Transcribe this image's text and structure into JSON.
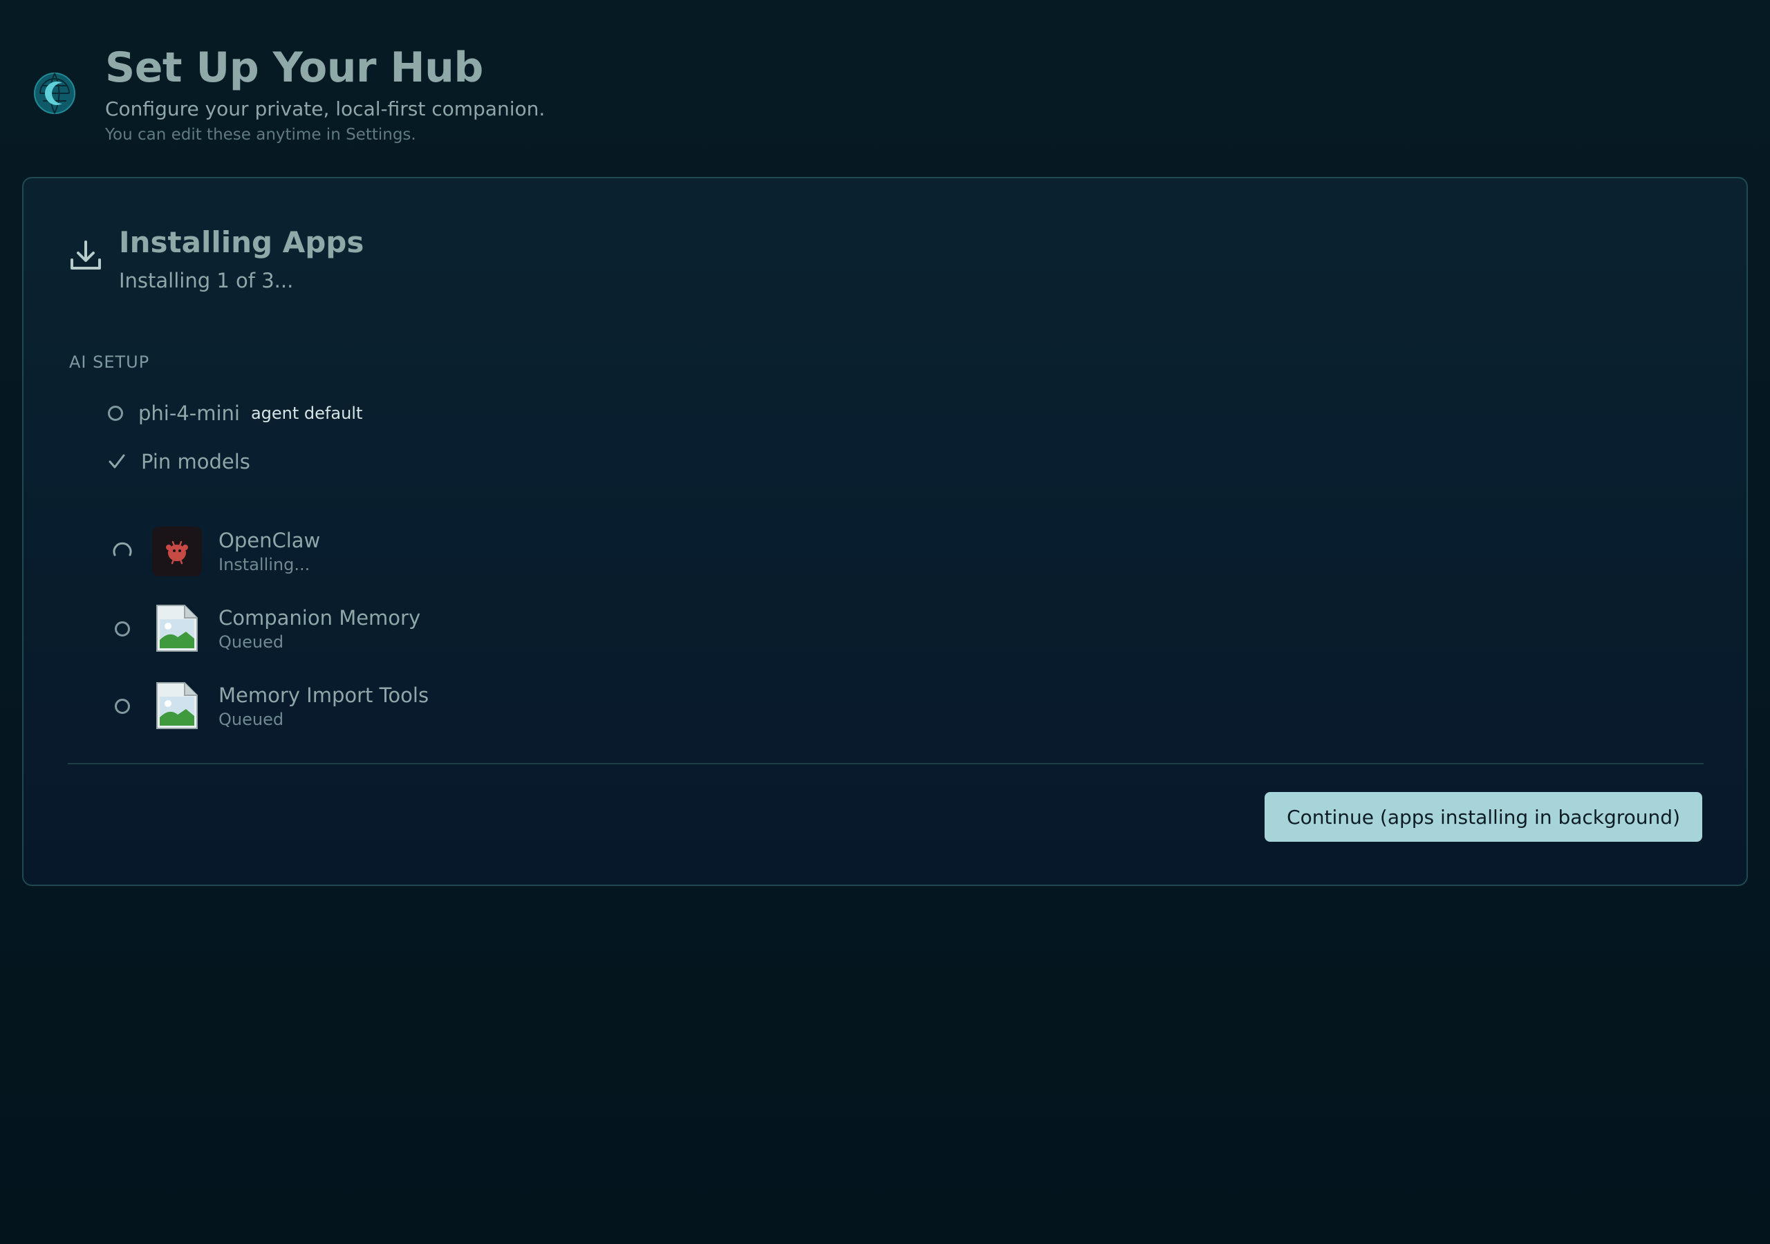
{
  "header": {
    "title": "Set Up Your Hub",
    "subtitle": "Configure your private, local-first companion.",
    "hint": "You can edit these anytime in Settings."
  },
  "step": {
    "icon": "download-icon",
    "title": "Installing Apps",
    "progress_text": "Installing 1 of 3..."
  },
  "ai_setup": {
    "section_label": "AI SETUP",
    "model": {
      "name": "phi-4-mini",
      "badge": "agent default",
      "status": "pending"
    },
    "pin": {
      "label": "Pin models",
      "status": "done"
    }
  },
  "apps": [
    {
      "name": "OpenClaw",
      "state": "Installing...",
      "status": "installing",
      "icon": "openclaw-app-icon"
    },
    {
      "name": "Companion Memory",
      "state": "Queued",
      "status": "queued",
      "icon": "broken-image-icon"
    },
    {
      "name": "Memory Import Tools",
      "state": "Queued",
      "status": "queued",
      "icon": "broken-image-icon"
    }
  ],
  "footer": {
    "continue_label": "Continue (apps installing in background)"
  },
  "colors": {
    "background": "#061620",
    "card_border": "#1f4a52",
    "accent_button": "#a7d4d9",
    "text_primary": "#8fa9a9",
    "text_muted": "#6f8a90"
  }
}
